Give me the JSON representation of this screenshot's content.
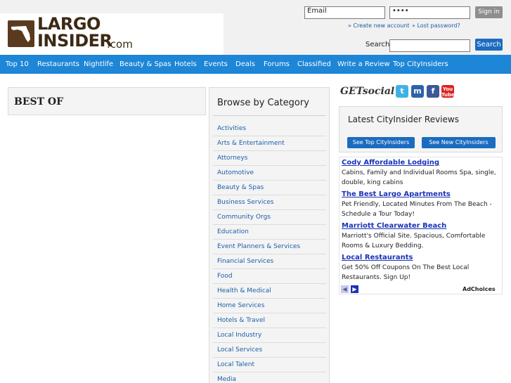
{
  "header": {
    "logo_line1": "LARGO",
    "logo_line2": "INSIDER",
    "logo_suffix": ".com",
    "email_value": "Email",
    "password_value": "••••",
    "signin_label": "Sign in",
    "create_account": "» Create new account",
    "lost_password": "» Lost password?",
    "search_label": "Search",
    "search_value": "",
    "search_button": "Search"
  },
  "nav": [
    "Top 10",
    "Restaurants",
    "Nightlife",
    "Beauty & Spas",
    "Hotels",
    "Events",
    "Deals",
    "Forums",
    "Classified",
    "Write a Review",
    "Top CityInsiders"
  ],
  "best_of": {
    "title": "BEST OF"
  },
  "categories": {
    "title": "Browse by Category",
    "items": [
      "Activities",
      "Arts & Entertainment",
      "Attorneys",
      "Automotive",
      "Beauty & Spas",
      "Business Services",
      "Community Orgs",
      "Education",
      "Event Planners & Services",
      "Financial Services",
      "Food",
      "Health & Medical",
      "Home Services",
      "Hotels & Travel",
      "Local Industry",
      "Local Services",
      "Local Talent",
      "Media"
    ]
  },
  "social": {
    "label": "GETsocial",
    "icons": [
      "twitter-icon",
      "myspace-icon",
      "facebook-icon",
      "youtube-icon"
    ]
  },
  "reviews": {
    "title": "Latest CityInsider Reviews",
    "btn_top": "See Top CityInsiders",
    "btn_new": "See New CityInsiders"
  },
  "ads": {
    "items": [
      {
        "title": "Cody Affordable Lodging",
        "text": "Cabins, Family and Individual Rooms Spa, single, double, king cabins"
      },
      {
        "title": "The Best Largo Apartments",
        "text": "Pet Friendly, Located Minutes From The Beach - Schedule a Tour Today!"
      },
      {
        "title": "Marriott Clearwater Beach",
        "text": "Marriott's Official Site. Spacious, Comfortable Rooms & Luxury Bedding."
      },
      {
        "title": "Local Restaurants",
        "text": "Get 50% Off Coupons On The Best Local Restaurants. Sign Up!"
      }
    ],
    "adchoices": "AdChoices"
  },
  "colors": {
    "nav_bg": "#1e86d6",
    "button_blue": "#1b6cc0",
    "link": "#1a5ea8",
    "ad_link": "#1a33b8"
  }
}
